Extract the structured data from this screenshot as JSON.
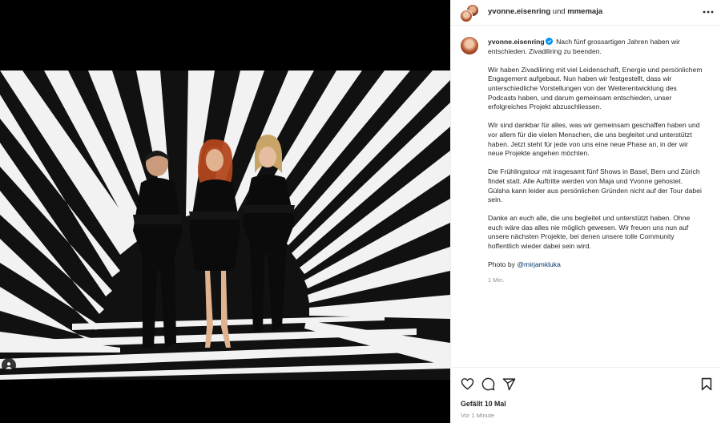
{
  "post": {
    "header": {
      "author": "yvonne.eisenring",
      "conjunction": " und ",
      "coauthor": "mmemaja"
    },
    "caption": {
      "username": "yvonne.eisenring",
      "intro": "Nach fünf grossartigen Jahren haben wir entschieden. Zivadiliring zu beenden.",
      "paragraphs": [
        "Wir haben Zivadiliring mit viel Leidenschaft, Energie und persönlichem Engagement aufgebaut. Nun haben wir festgestellt, dass wir unterschiedliche Vorstellungen von der Weiterentwicklung des Podcasts haben, und darum gemeinsam entschieden, unser erfolgreiches Projekt abzuschliessen.",
        "Wir sind dankbar für alles, was wir gemeinsam geschaffen haben und vor allem für die vielen Menschen, die uns begleitet und unterstützt haben. Jetzt steht für jede von uns eine neue Phase an, in der wir neue Projekte angehen möchten.",
        "Die Frühlingstour mit insgesamt fünf Shows in Basel, Bern und Zürich findet statt. Alle Auftritte werden von Maja und Yvonne gehostet. Gülsha kann leider aus persönlichen Gründen nicht auf der Tour dabei sein.",
        "Danke an euch alle, die uns begleitet und unterstützt haben. Ohne euch wäre das alles nie möglich gewesen. Wir freuen uns nun auf unsere nächsten Projekte, bei denen unsere tolle Community hoffentlich wieder dabei sein wird."
      ],
      "photo_credit_prefix": "Photo by ",
      "photo_credit_handle": "@mirjamkluka",
      "relative_time": "1 Min."
    },
    "likes": "Gefällt 10 Mal",
    "posted_ago": "Vor 1 Minute"
  },
  "icons": {
    "more": "more-options-icon",
    "like": "heart-icon",
    "comment": "comment-icon",
    "share": "send-icon",
    "save": "bookmark-icon",
    "tag": "user-tag-icon",
    "verified": "verified-badge-icon"
  },
  "colors": {
    "verified": "#0095f6",
    "link": "#00376b",
    "muted": "#8e8e8e"
  }
}
